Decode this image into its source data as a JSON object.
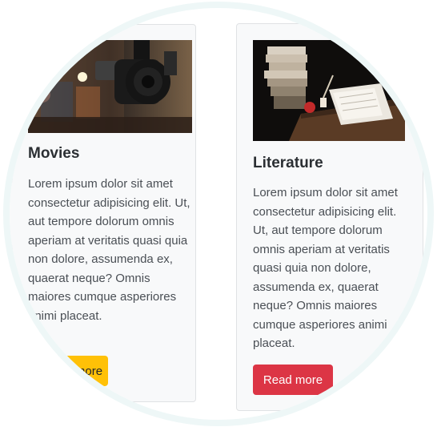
{
  "cards": [
    {
      "id": "movies",
      "title": "Movies",
      "image_label": "film-camera-photo",
      "text": "Lorem ipsum dolor sit amet consectetur adipisicing elit. Ut, aut tempore dolorum omnis aperiam at veritatis quasi quia non dolore, assumenda ex, quaerat neque? Omnis maiores cumque asperiores animi placeat.",
      "button_label": "Read more",
      "button_color": "#ffc107"
    },
    {
      "id": "literature",
      "title": "Literature",
      "image_label": "books-and-papers-photo",
      "text": "Lorem ipsum dolor sit amet consectetur adipisicing elit. Ut, aut tempore dolorum omnis aperiam at veritatis quasi quia non dolore, assumenda ex, quaerat neque? Omnis maiores cumque asperiores animi placeat.",
      "button_label": "Read more",
      "button_color": "#dc3545"
    }
  ],
  "colors": {
    "card_background": "#f8f9fa",
    "ring": "#eef7f7",
    "title": "#2b2f33",
    "body_text": "#4a4f55"
  }
}
